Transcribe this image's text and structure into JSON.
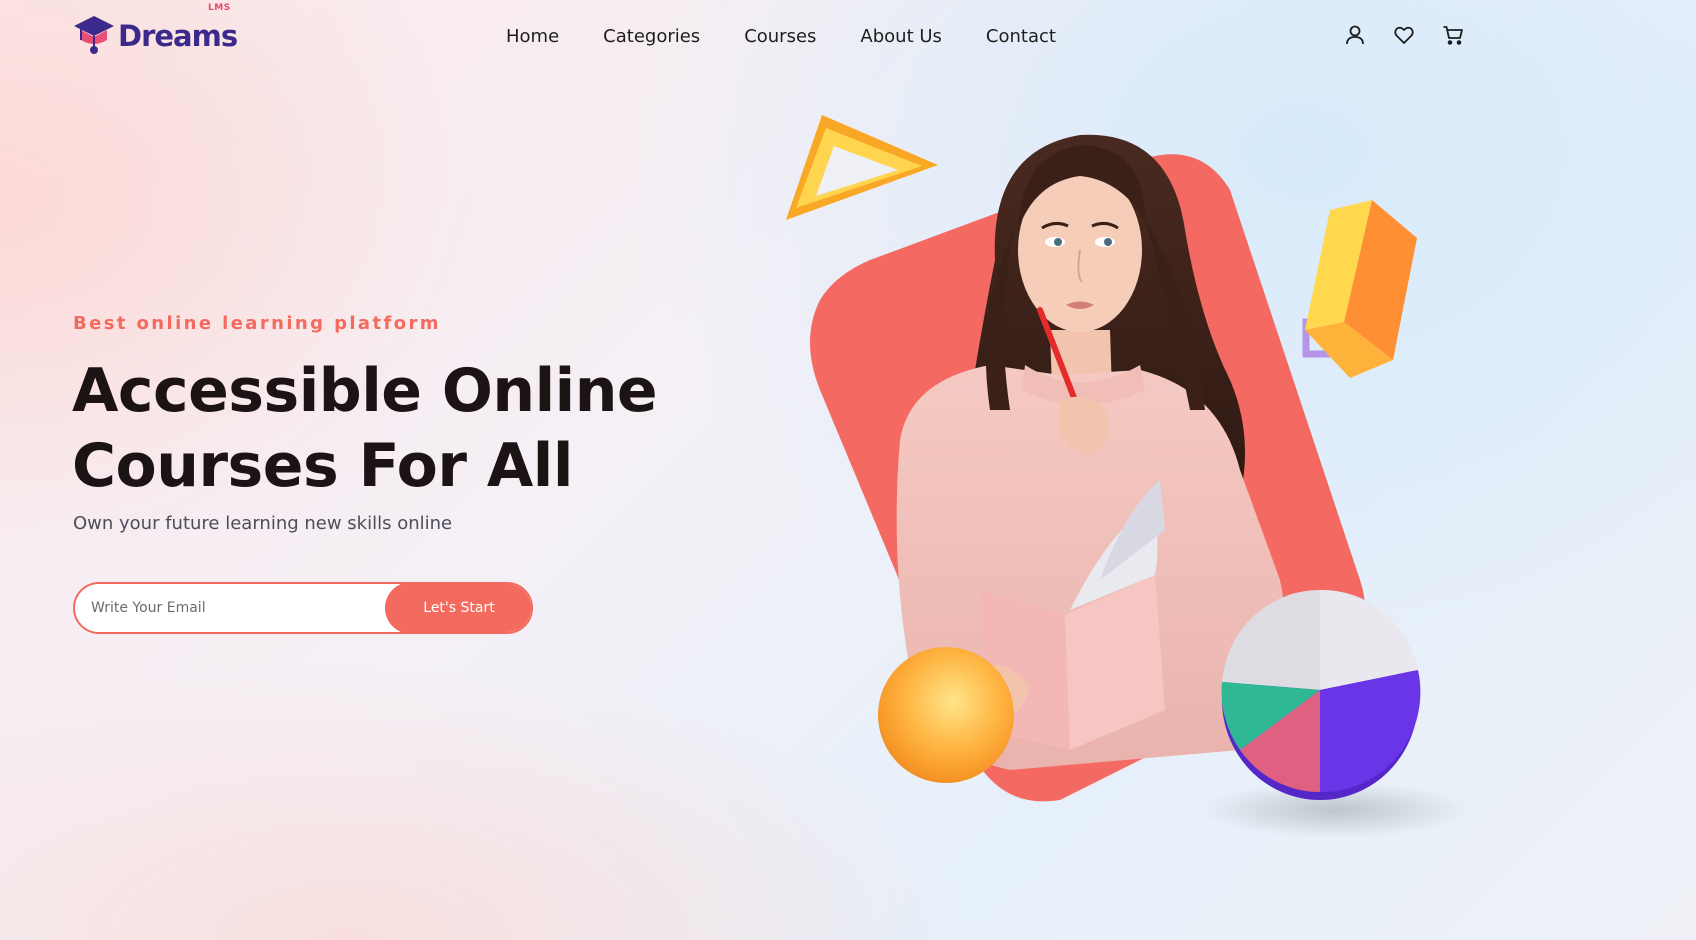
{
  "brand": {
    "name": "Dreams",
    "superscript": "LMS"
  },
  "nav": {
    "items": [
      "Home",
      "Categories",
      "Courses",
      "About Us",
      "Contact"
    ]
  },
  "header_icons": [
    "user-icon",
    "heart-icon",
    "cart-icon"
  ],
  "hero": {
    "eyebrow": "Best online learning platform",
    "headline_line1": "Accessible Online",
    "headline_line2": "Courses For All",
    "subtext": "Own your future learning new skills online",
    "email_placeholder": "Write Your Email",
    "cta_label": "Let's Start"
  },
  "colors": {
    "accent": "#f36a5f",
    "brand": "#3b2a8c",
    "heading": "#1c1314"
  }
}
